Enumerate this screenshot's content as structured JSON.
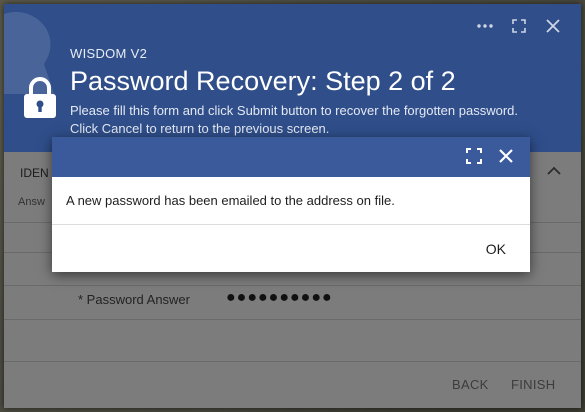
{
  "header": {
    "app_name": "WISDOM V2",
    "title": "Password Recovery: Step 2 of 2",
    "description_line1": "Please fill this form and click Submit button to recover the forgotten password.",
    "description_line2": "Click Cancel to return to the previous screen.",
    "icons": [
      "more-icon",
      "maximize-icon",
      "close-icon",
      "lock-icon"
    ]
  },
  "form": {
    "section_title": "IDEN",
    "hint": "Answ",
    "fields": [
      {
        "label": "* Password Answer",
        "value": "●●●●●●●●●●"
      }
    ]
  },
  "footer": {
    "back_label": "BACK",
    "finish_label": "FINISH"
  },
  "dialog": {
    "message": "A new password has been emailed to the address on file.",
    "ok_label": "OK",
    "icons": [
      "fullscreen-icon",
      "close-icon"
    ]
  },
  "colors": {
    "header_bg": "#2f4e8a",
    "dialog_header_bg": "#3a5a9c",
    "dim_panel": "#7c7c7c"
  }
}
